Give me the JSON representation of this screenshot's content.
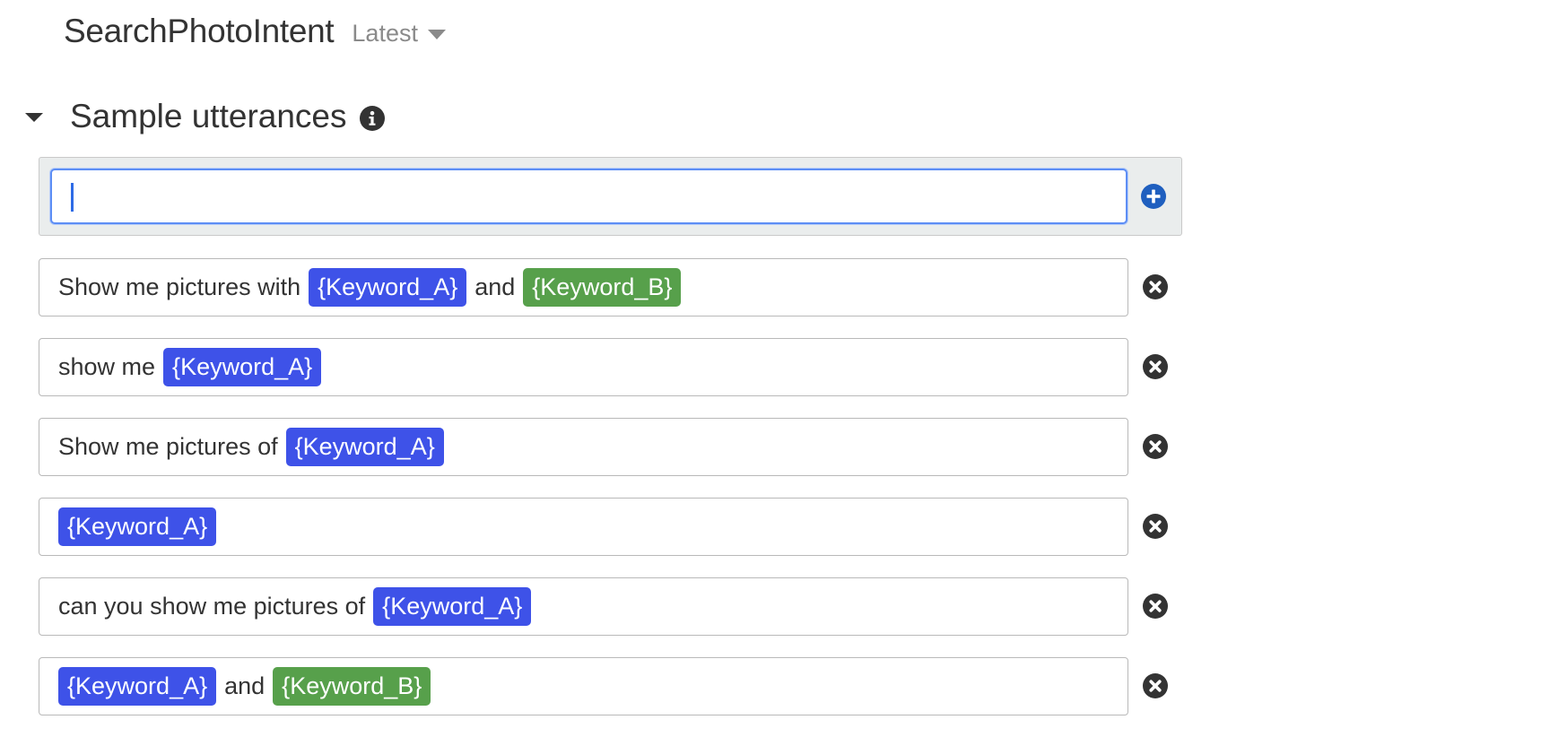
{
  "intent": {
    "name": "SearchPhotoIntent",
    "version_label": "Latest"
  },
  "section": {
    "title": "Sample utterances"
  },
  "new_utterance": {
    "value": "",
    "placeholder": ""
  },
  "colors": {
    "slot_keyword_a": "#3e52e8",
    "slot_keyword_b": "#57a04b",
    "input_focus": "#5d8ef5",
    "add_button": "#1f5fbf"
  },
  "icons": {
    "version_dropdown": "caret-down-icon",
    "section_toggle": "caret-down-icon",
    "info": "info-icon",
    "add": "plus-circle-icon",
    "remove": "x-circle-icon"
  },
  "utterances": [
    {
      "segments": [
        {
          "type": "text",
          "value": "Show me pictures with"
        },
        {
          "type": "slot",
          "slot": "a",
          "value": "{Keyword_A}"
        },
        {
          "type": "text",
          "value": "and"
        },
        {
          "type": "slot",
          "slot": "b",
          "value": "{Keyword_B}"
        }
      ]
    },
    {
      "segments": [
        {
          "type": "text",
          "value": "show me"
        },
        {
          "type": "slot",
          "slot": "a",
          "value": "{Keyword_A}"
        }
      ]
    },
    {
      "segments": [
        {
          "type": "text",
          "value": "Show me pictures of"
        },
        {
          "type": "slot",
          "slot": "a",
          "value": "{Keyword_A}"
        }
      ]
    },
    {
      "segments": [
        {
          "type": "slot",
          "slot": "a",
          "value": "{Keyword_A}"
        }
      ]
    },
    {
      "segments": [
        {
          "type": "text",
          "value": "can you show me pictures of"
        },
        {
          "type": "slot",
          "slot": "a",
          "value": "{Keyword_A}"
        }
      ]
    },
    {
      "segments": [
        {
          "type": "slot",
          "slot": "a",
          "value": "{Keyword_A}"
        },
        {
          "type": "text",
          "value": "and"
        },
        {
          "type": "slot",
          "slot": "b",
          "value": "{Keyword_B}"
        }
      ]
    }
  ]
}
